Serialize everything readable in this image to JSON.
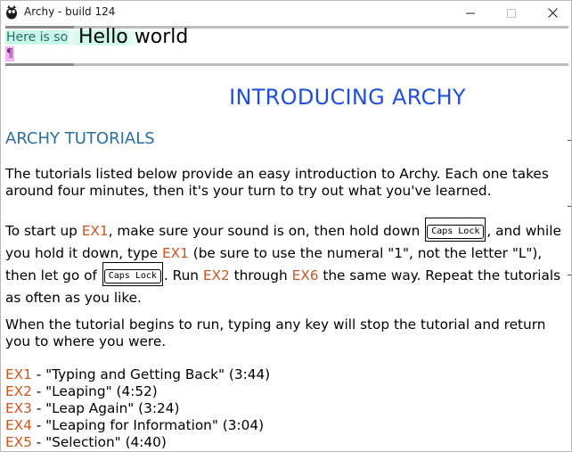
{
  "window": {
    "title": "Archy - build 124",
    "icon": "archy-app-icon",
    "controls": [
      "minimize-icon",
      "maximize-icon",
      "close-icon"
    ]
  },
  "editor": {
    "here_text": "Here is so",
    "hello_text": "Hello world",
    "pilcrow": "¶",
    "colors": {
      "here_bg": "#c9f7e8",
      "pilcrow_bg": "#f3b6f3"
    }
  },
  "document": {
    "title": "INTRODUCING ARCHY",
    "subtitle": "ARCHY TUTORIALS",
    "p1": "The tutorials listed below provide an easy introduction to Archy. Each one takes around four minutes, then it's your turn to try out what you've learned.",
    "p2": {
      "a": "To start up ",
      "cmd1": "EX1",
      "b": ", make sure your sound is on, then hold down ",
      "key1": "Caps Lock",
      "c": ", and while you hold it down, type ",
      "cmd2": "EX1",
      "d": " (be sure to use the numeral \"1\", not the letter \"L\"), then let go of ",
      "key2": "Caps Lock",
      "e": ". Run ",
      "cmd3": "EX2",
      "f": " through ",
      "cmd4": "EX6",
      "g": " the same way. Repeat the tutorials as often as you like."
    },
    "p3": "When the tutorial begins to run, typing any key will stop the tutorial and return you to where you were.",
    "tutorials": [
      {
        "cmd": "EX1",
        "desc": " - \"Typing and Getting Back\" (3:44)"
      },
      {
        "cmd": "EX2",
        "desc": " - \"Leaping\" (4:52)"
      },
      {
        "cmd": "EX3",
        "desc": " - \"Leap Again\" (3:24)"
      },
      {
        "cmd": "EX4",
        "desc": " - \"Leaping for Information\" (3:04)"
      },
      {
        "cmd": "EX5",
        "desc": " - \"Selection\" (4:40)"
      }
    ],
    "colors": {
      "title": "#1e4fe0",
      "subtitle": "#2a6fa0",
      "command": "#d2541e"
    }
  }
}
